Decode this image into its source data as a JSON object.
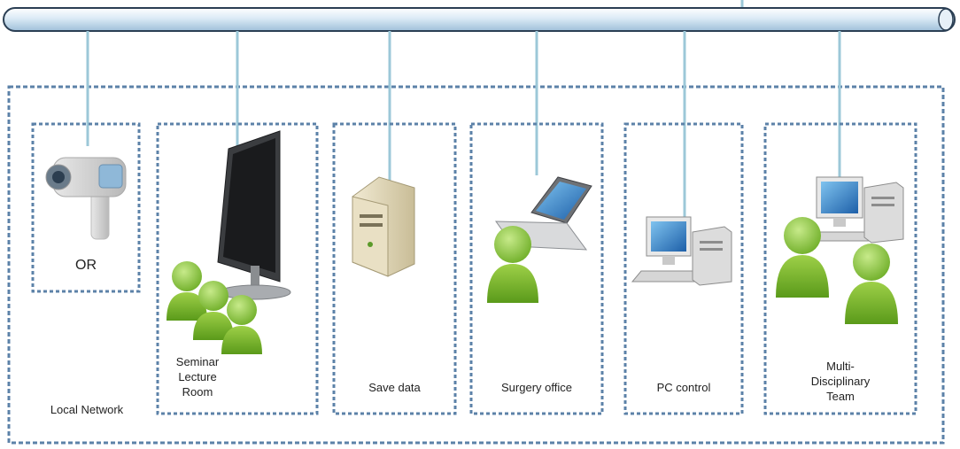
{
  "network": {
    "backbone_color": "#c8dff0",
    "drop_line_color": "#9cc8d8",
    "frame_color": "#5c82a8",
    "local_label": "Local Network"
  },
  "nodes": [
    {
      "id": "or",
      "label": "OR",
      "icon": "ceiling-camera-icon"
    },
    {
      "id": "seminar",
      "label_lines": [
        "Seminar",
        "Lecture",
        "Room"
      ],
      "icon": "monitor-icon",
      "people": 3
    },
    {
      "id": "save",
      "label": "Save data",
      "icon": "server-tower-icon"
    },
    {
      "id": "surgery",
      "label": "Surgery office",
      "icon": "laptop-icon",
      "people": 1
    },
    {
      "id": "pc",
      "label": "PC control",
      "icon": "desktop-computer-icon"
    },
    {
      "id": "mdt",
      "label_lines": [
        "Multi-",
        "Disciplinary",
        "Team"
      ],
      "icon": "desktop-computer-icon",
      "people": 2
    }
  ],
  "colors": {
    "person_green": "#8dc43e",
    "person_dark": "#5e9a1e",
    "screen_blue": "#2d7fc8"
  }
}
